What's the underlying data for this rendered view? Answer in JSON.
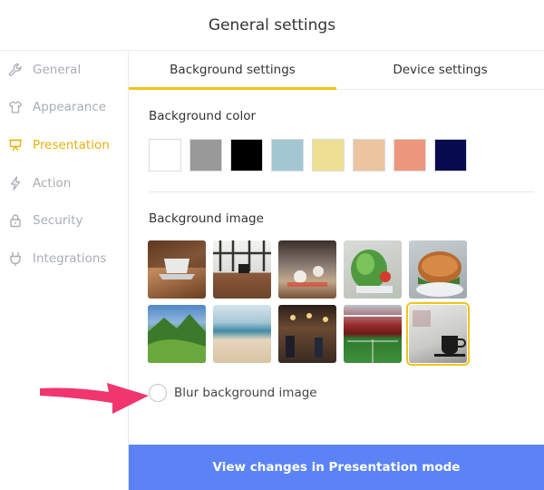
{
  "header": {
    "title": "General settings"
  },
  "sidebar": {
    "items": [
      {
        "label": "General",
        "icon": "wrench-icon",
        "active": false
      },
      {
        "label": "Appearance",
        "icon": "shirt-icon",
        "active": false
      },
      {
        "label": "Presentation",
        "icon": "presentation-icon",
        "active": true
      },
      {
        "label": "Action",
        "icon": "lightning-icon",
        "active": false
      },
      {
        "label": "Security",
        "icon": "lock-icon",
        "active": false
      },
      {
        "label": "Integrations",
        "icon": "plug-icon",
        "active": false
      }
    ],
    "active_color": "#e8b20e",
    "inactive_color": "#a9adb4"
  },
  "tabs": [
    {
      "label": "Background settings",
      "active": true
    },
    {
      "label": "Device settings",
      "active": false
    }
  ],
  "background_color": {
    "title": "Background color",
    "swatches": [
      "#ffffff",
      "#999999",
      "#000000",
      "#a3c6d3",
      "#ede093",
      "#ecc5a0",
      "#ec977d",
      "#060b4f"
    ]
  },
  "background_image": {
    "title": "Background image",
    "images": [
      {
        "name": "laptop-on-desk-image"
      },
      {
        "name": "window-desk-image"
      },
      {
        "name": "cafe-table-image"
      },
      {
        "name": "salad-image"
      },
      {
        "name": "bagel-image"
      },
      {
        "name": "mountain-valley-image"
      },
      {
        "name": "beach-image"
      },
      {
        "name": "restaurant-interior-image"
      },
      {
        "name": "stadium-image"
      },
      {
        "name": "coffee-cup-image",
        "selected": true
      }
    ]
  },
  "blur": {
    "label": "Blur background image",
    "checked": false
  },
  "apply_button": {
    "label": "View changes in Presentation mode"
  },
  "colors": {
    "accent": "#f0c419",
    "button": "#5b83f6",
    "annotation_arrow": "#f0356f"
  }
}
